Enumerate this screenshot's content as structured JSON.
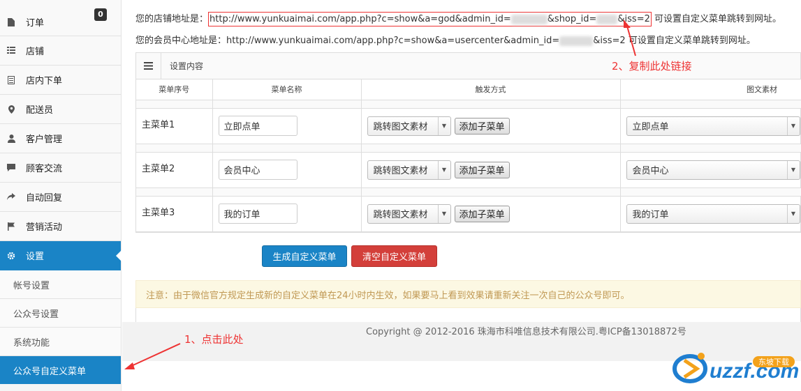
{
  "sidebar": {
    "items": [
      {
        "icon": "file-icon",
        "label": "订单",
        "badge": "0"
      },
      {
        "icon": "list-icon",
        "label": "店铺"
      },
      {
        "icon": "document-icon",
        "label": "店内下单"
      },
      {
        "icon": "map-marker-icon",
        "label": "配送员"
      },
      {
        "icon": "user-icon",
        "label": "客户管理"
      },
      {
        "icon": "comment-icon",
        "label": "顾客交流"
      },
      {
        "icon": "share-icon",
        "label": "自动回复"
      },
      {
        "icon": "flag-icon",
        "label": "营销活动"
      },
      {
        "icon": "gear-icon",
        "label": "设置"
      }
    ],
    "sub_items": [
      "帐号设置",
      "公众号设置",
      "系统功能",
      "公众号自定义菜单"
    ]
  },
  "urls": {
    "shop_prefix": "您的店铺地址是：",
    "shop_url_a": "http://www.yunkuaimai.com/app.php?c=show&a=god&admin_id=",
    "shop_url_b": "&shop_id=",
    "shop_url_c": "&iss=2",
    "shop_suffix": " 可设置自定义菜单跳转到网址。",
    "member_prefix": "您的会员中心地址是：",
    "member_url_a": "http://www.yunkuaimai.com/app.php?c=show&a=usercenter&admin_id=",
    "member_url_b": "&iss=2",
    "member_suffix": " 可设置自定义菜单跳转到网址。"
  },
  "panel": {
    "title": "设置内容",
    "columns": [
      "菜单序号",
      "菜单名称",
      "触发方式",
      "图文素材"
    ],
    "rows": [
      {
        "name": "主菜单1",
        "menu_name": "立即点单",
        "trigger": "跳转图文素材",
        "add_sub": "添加子菜单",
        "material": "立即点单"
      },
      {
        "name": "主菜单2",
        "menu_name": "会员中心",
        "trigger": "跳转图文素材",
        "add_sub": "添加子菜单",
        "material": "会员中心"
      },
      {
        "name": "主菜单3",
        "menu_name": "我的订单",
        "trigger": "跳转图文素材",
        "add_sub": "添加子菜单",
        "material": "我的订单"
      }
    ]
  },
  "actions": {
    "generate": "生成自定义菜单",
    "clear": "清空自定义菜单"
  },
  "notice": "注意：由于微信官方规定生成新的自定义菜单在24小时内生效，如果要马上看到效果请重新关注一次自己的公众号即可。",
  "footer": {
    "copyright": "Copyright @ 2012-2016 珠海市科唯信息技术有限公司.粤ICP备13018872号"
  },
  "annotations": {
    "step1": "1、点击此处",
    "step2": "2、复制此处链接"
  },
  "watermark": {
    "text": "uzzf.com",
    "tag": "东坡下载"
  },
  "colors": {
    "primary": "#1a84c6",
    "danger": "#d33f3a",
    "annotation": "#ee3333",
    "notice_bg": "#fcf8e3"
  }
}
